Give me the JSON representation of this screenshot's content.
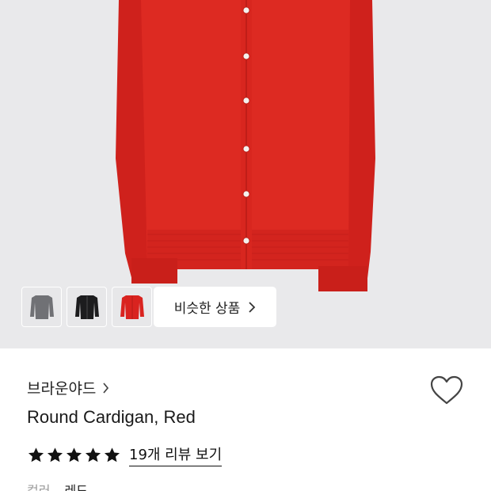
{
  "gallery": {
    "thumbnails": [
      {
        "name": "thumb-gray-cardigan",
        "color": "#6e6f73"
      },
      {
        "name": "thumb-black-cardigan",
        "color": "#1c1c1e"
      },
      {
        "name": "thumb-red-cardigan",
        "color": "#d9231f"
      }
    ],
    "similar_button_label": "비슷한 상품",
    "product_color": "#dd2a22"
  },
  "product": {
    "brand": "브라운야드",
    "title": "Round Cardigan, Red",
    "rating_stars": 5,
    "review_link": "19개 리뷰 보기",
    "color_label": "컬러",
    "color_value": "레드"
  },
  "icons": {
    "brand_chevron": "chevron-right-icon",
    "similar_chevron": "chevron-right-icon",
    "wishlist": "heart-outline-icon",
    "star": "star-filled-icon"
  }
}
